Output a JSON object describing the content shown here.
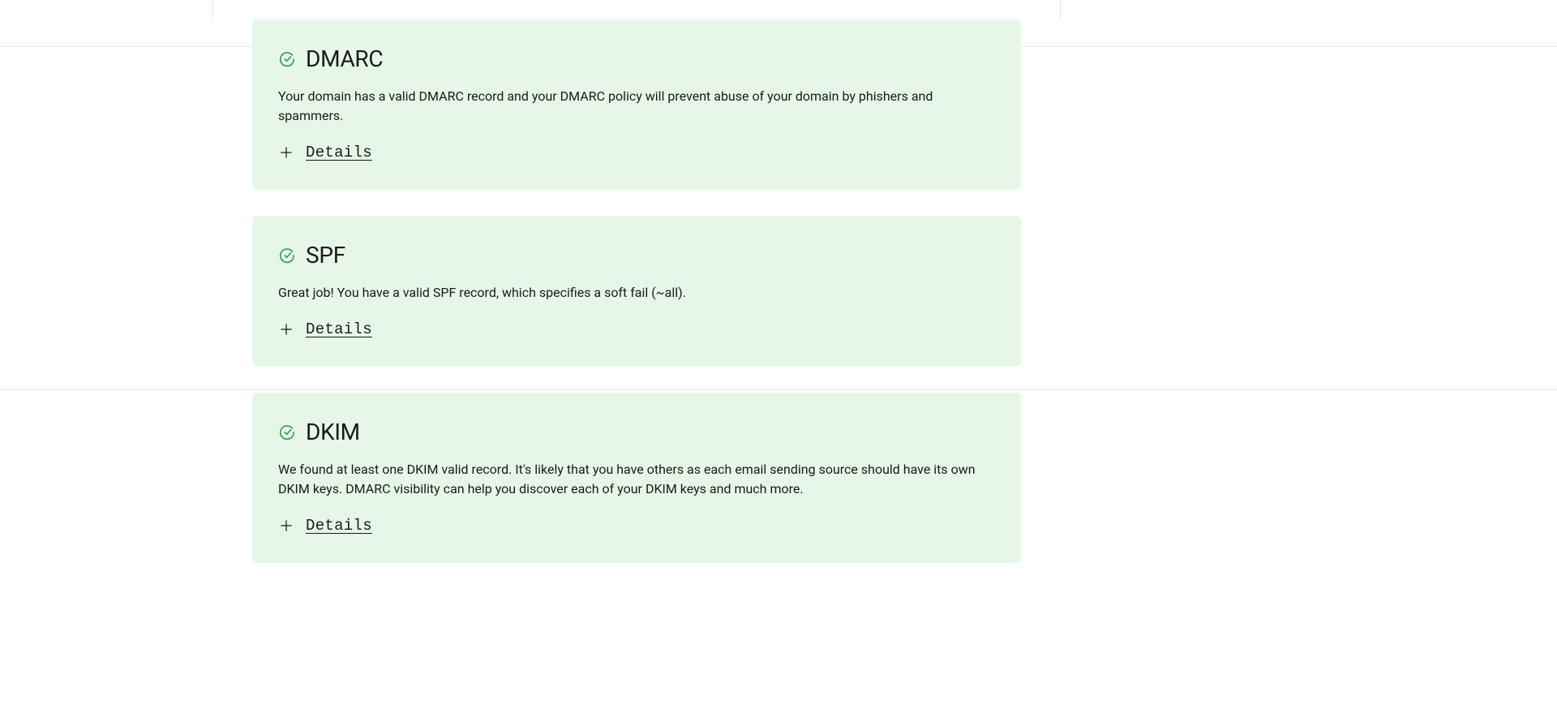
{
  "cards": [
    {
      "title": "DMARC",
      "description": "Your domain has a valid DMARC record and your DMARC policy will prevent abuse of your domain by phishers and spammers.",
      "details_label": "Details"
    },
    {
      "title": "SPF",
      "description": "Great job! You have a valid SPF record, which specifies a soft fail (~all).",
      "details_label": "Details"
    },
    {
      "title": "DKIM",
      "description": "We found at least one DKIM valid record. It's likely that you have others as each email sending source should have its own DKIM keys. DMARC visibility can help you discover each of your DKIM keys and much more.",
      "details_label": "Details"
    }
  ],
  "colors": {
    "card_bg": "#e6f7e8",
    "icon_green": "#3d9850",
    "text_dark": "#1a1a1a"
  }
}
